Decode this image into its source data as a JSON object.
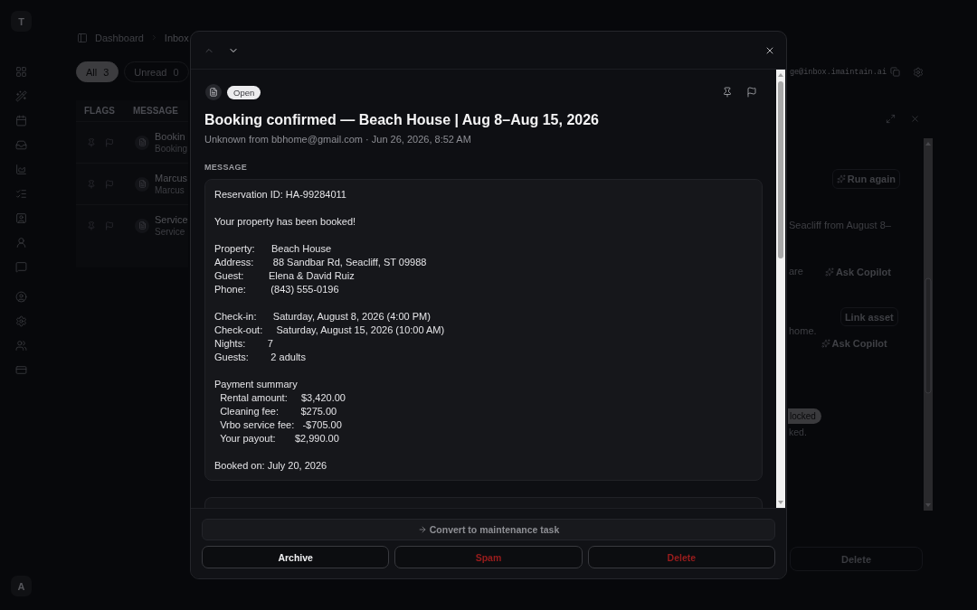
{
  "sidebar": {
    "logo": "T",
    "avatar": "A"
  },
  "breadcrumb": [
    "Dashboard",
    "Inbox"
  ],
  "filters": [
    {
      "label": "All",
      "count": "3",
      "selected": true
    },
    {
      "label": "Unread",
      "count": "0",
      "selected": false
    }
  ],
  "inbox_address": "ge@inbox.imaintain.ai",
  "table": {
    "columns": [
      "FLAGS",
      "MESSAGE"
    ],
    "rows": [
      {
        "title": "Bookin",
        "subtitle": "Booking"
      },
      {
        "title": "Marcus",
        "subtitle": "Marcus"
      },
      {
        "title": "Service",
        "subtitle": "Service"
      }
    ]
  },
  "detail_panel": {
    "run_button": "Run again",
    "summary": "Seacliff from August 8–",
    "suggestions": [
      {
        "text": "are",
        "button": "Ask Copilot"
      },
      {
        "text": "home.",
        "link_button": "Link asset",
        "button": "Ask Copilot"
      }
    ],
    "status_badge": "locked",
    "note": "ked.",
    "delete_button": "Delete"
  },
  "message_dialog": {
    "nav_buttons": [
      {
        "kind": "previous",
        "disabled": true
      },
      {
        "kind": "next",
        "disabled": false
      }
    ],
    "status": "Open",
    "title": "Booking confirmed — Beach House | Aug 8–Aug 15, 2026",
    "meta": "Unknown from bbhome@gmail.com · Jun 26, 2026, 8:52 AM",
    "section_label": "MESSAGE",
    "body": "Reservation ID: HA-99284011\n\nYour property has been booked!\n\nProperty:      Beach House\nAddress:       88 Sandbar Rd, Seacliff, ST 09988\nGuest:         Elena & David Ruiz\nPhone:         (843) 555-0196\n\nCheck-in:      Saturday, August 8, 2026 (4:00 PM)\nCheck-out:     Saturday, August 15, 2026 (10:00 AM)\nNights:        7\nGuests:        2 adults\n\nPayment summary\n  Rental amount:     $3,420.00\n  Cleaning fee:        $275.00\n  Vrbo service fee:   -$705.00\n  Your payout:       $2,990.00\n\nBooked on: July 20, 2026",
    "convert_button": "Convert to maintenance task",
    "actions": [
      {
        "label": "Archive",
        "kind": "archive"
      },
      {
        "label": "Spam",
        "kind": "spam"
      },
      {
        "label": "Delete",
        "kind": "delete"
      }
    ]
  }
}
